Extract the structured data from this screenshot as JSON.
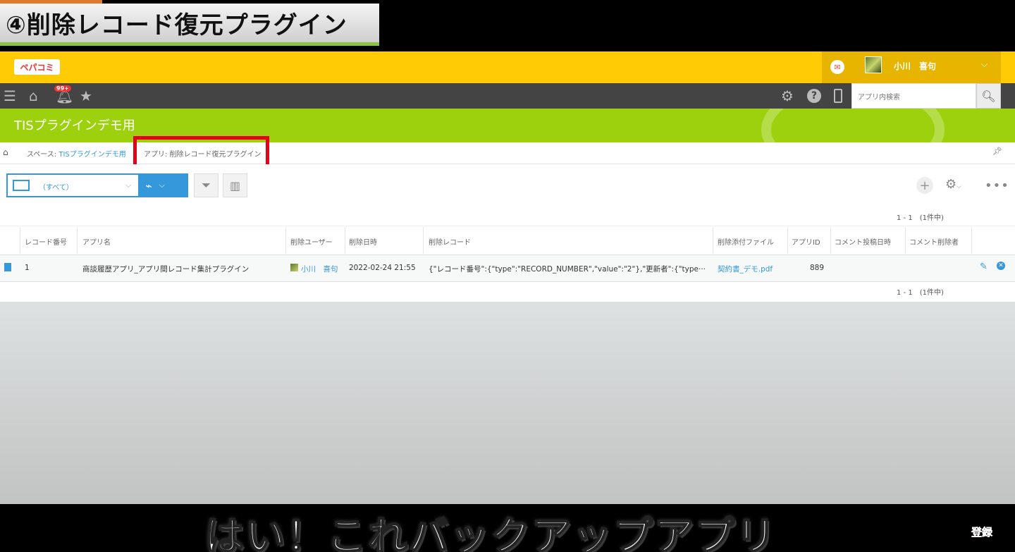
{
  "overlay": {
    "title": "④削除レコード復元プラグイン",
    "subtitle": "はい！これバックアップアプリ",
    "subscribe": "登録"
  },
  "header": {
    "logo": "ペパコミ",
    "user_name": "小川　喜句",
    "mail_icon": "mail-icon",
    "notification_badge": "99+",
    "search_placeholder": "アプリ内検索"
  },
  "space": {
    "title": "TISプラグインデモ用"
  },
  "breadcrumb": {
    "space_prefix": "スペース: ",
    "space_name": "TISプラグインデモ用",
    "app": "アプリ: 削除レコード復元プラグイン"
  },
  "toolbar": {
    "view_name": "（すべて）"
  },
  "pager": {
    "top": "1 - 1　(1件中)",
    "bottom": "1 - 1　(1件中)"
  },
  "table": {
    "headers": [
      "レコード番号",
      "アプリ名",
      "削除ユーザー",
      "削除日時",
      "削除レコード",
      "削除添付ファイル",
      "アプリID",
      "コメント投稿日時",
      "コメント削除者"
    ],
    "rows": [
      {
        "record_no": "1",
        "app_name": "商談履歴アプリ_アプリ間レコード集計プラグイン",
        "deleted_by": "小川　喜句",
        "deleted_at": "2022-02-24 21:55",
        "deleted_record": "{\"レコード番号\":{\"type\":\"RECORD_NUMBER\",\"value\":\"2\"},\"更新者\":{\"type···",
        "attachment": "契約書_デモ.pdf",
        "app_id": "889",
        "comment_posted_at": "",
        "comment_deleted_by": ""
      }
    ]
  },
  "colors": {
    "header_yellow": "#ffcb05",
    "space_green": "#9dd10d",
    "accent_blue": "#3498db",
    "highlight_red": "#e3001b"
  }
}
